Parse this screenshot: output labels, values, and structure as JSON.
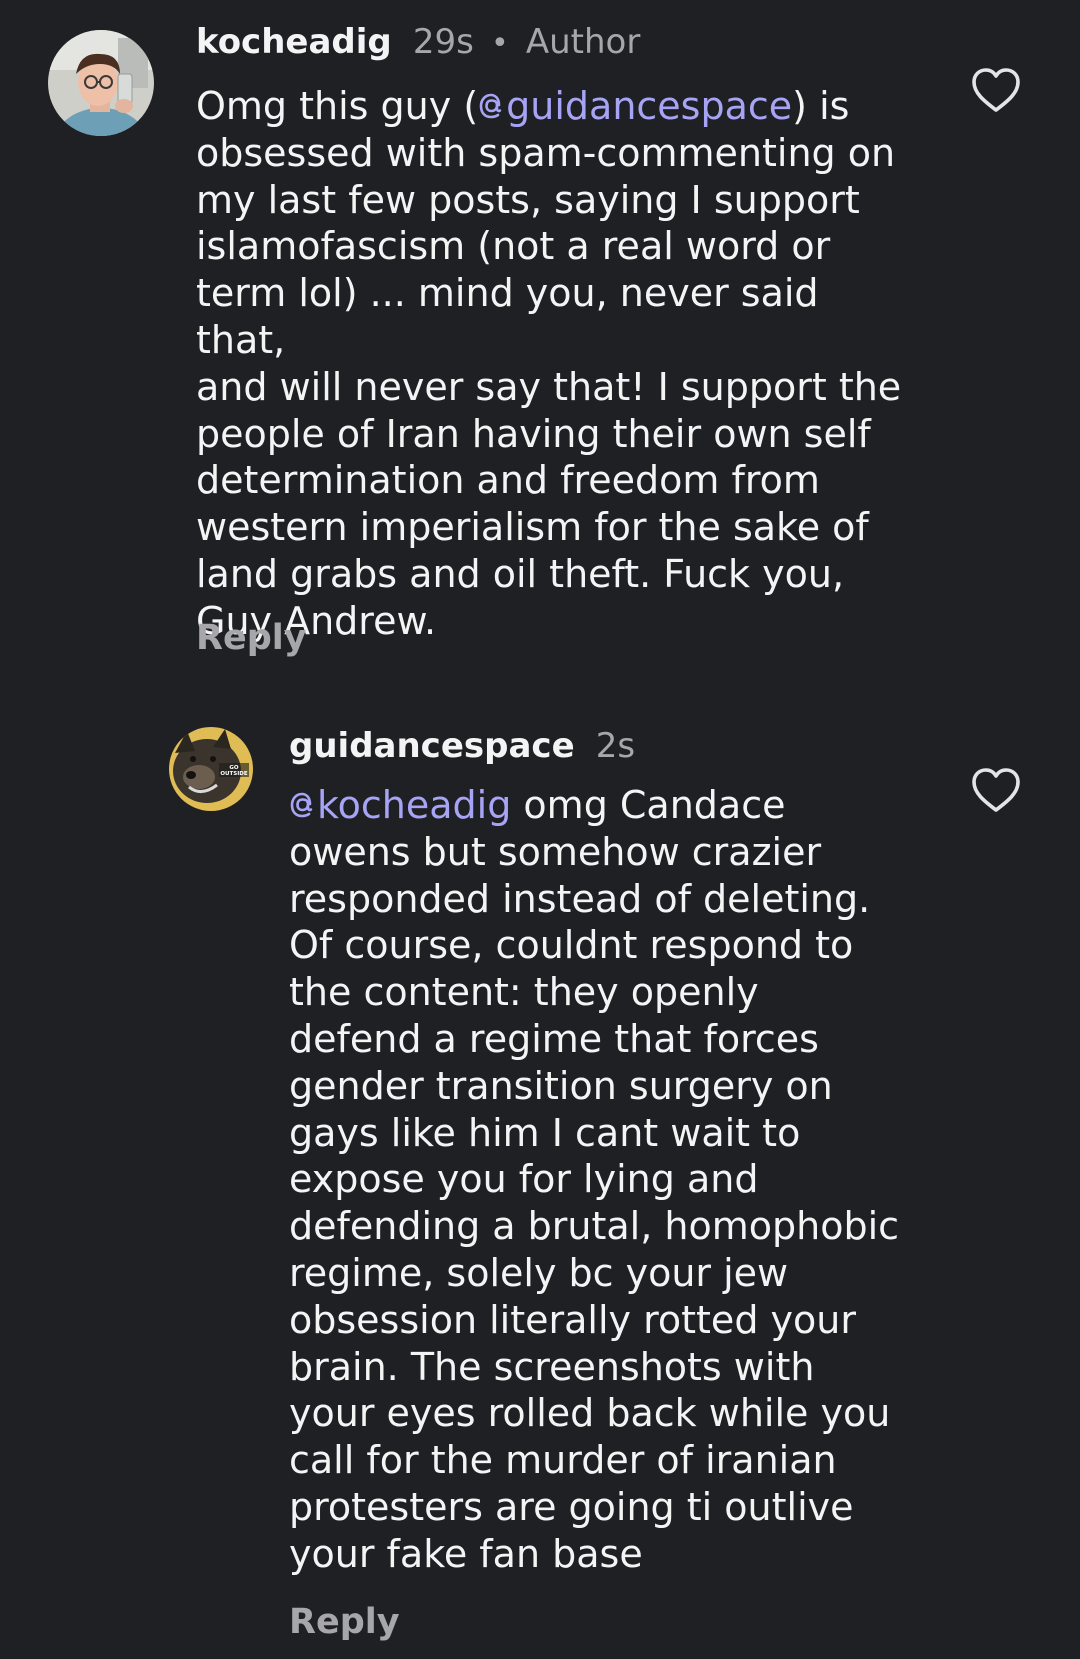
{
  "comments": [
    {
      "username": "kocheadig",
      "time": "29s",
      "separator": "•",
      "badge": "Author",
      "body_prefix": "Omg this guy (",
      "mention": "guidancespace",
      "body_rest": ") is\nobsessed with spam-commenting on\nmy last few posts, saying I support\nislamofascism (not a real word or\nterm lol) ... mind you, never said that,\nand will never say that! I support the\npeople of Iran having their own self\ndetermination and freedom from\nwestern imperialism for the sake of\nland grabs and oil theft. Fuck you,\nGuy Andrew.",
      "reply_label": "Reply",
      "avatar_icon": "user-photo-avatar",
      "like_icon": "heart-outline-icon"
    },
    {
      "username": "guidancespace",
      "time": "2s",
      "mention": "kocheadig",
      "body_rest": " omg Candace\nowens but somehow crazier\nresponded instead of deleting.\nOf course, couldnt respond to\nthe content: they openly\ndefend a regime that forces\ngender transition surgery on\ngays like him  I cant wait to\nexpose you for lying and\ndefending a brutal, homophobic\nregime, solely bc your jew\nobsession literally rotted your\nbrain. The screenshots with\nyour eyes rolled back while you\ncall for the murder of iranian\nprotesters are going ti outlive\nyour fake fan base",
      "reply_label": "Reply",
      "avatar_icon": "dog-photo-avatar",
      "like_icon": "heart-outline-icon"
    }
  ],
  "colors": {
    "background": "#1f2023",
    "text": "#f4f4f5",
    "secondary": "#a6a6ab",
    "mention": "#a7a4f6"
  }
}
